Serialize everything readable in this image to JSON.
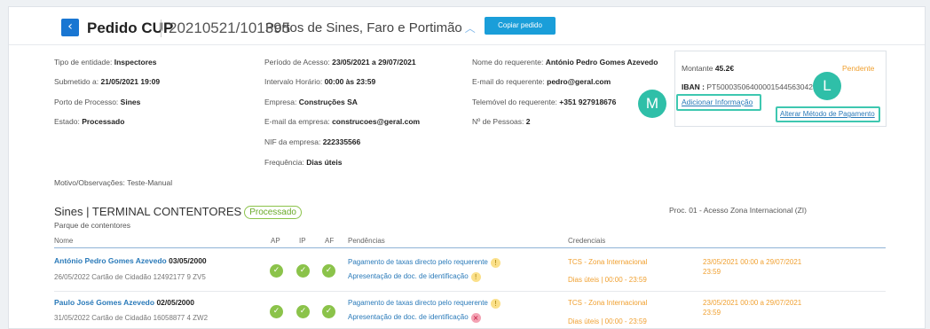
{
  "header": {
    "back_icon": "chevron-left-icon",
    "title": "Pedido CUP",
    "request_id": "20210521/101395",
    "ports": "Portos de Sines, Faro e Portimão",
    "copy_button": "Copiar pedido"
  },
  "details": {
    "col1": [
      {
        "label": "Tipo de entidade:",
        "value": "Inspectores"
      },
      {
        "label": "Submetido a:",
        "value": "21/05/2021 19:09"
      },
      {
        "label": "Porto de Processo:",
        "value": "Sines"
      },
      {
        "label": "Estado:",
        "value": "Processado"
      }
    ],
    "col2": [
      {
        "label": "Período de Acesso:",
        "value": "23/05/2021 a 29/07/2021"
      },
      {
        "label": "Intervalo Horário:",
        "value": "00:00 às 23:59"
      },
      {
        "label": "Empresa:",
        "value": "Construções SA"
      },
      {
        "label": "E-mail da empresa:",
        "value": "construcoes@geral.com"
      },
      {
        "label": "NIF da empresa:",
        "value": "222335566"
      },
      {
        "label": "Frequência:",
        "value": "Dias úteis"
      }
    ],
    "col3": [
      {
        "label": "Nome do requerente:",
        "value": "António Pedro Gomes Azevedo"
      },
      {
        "label": "E-mail do requerente:",
        "value": "pedro@geral.com"
      },
      {
        "label": "Telemóvel do requerente:",
        "value": "+351 927918676"
      },
      {
        "label": "Nº de Pessoas:",
        "value": "2"
      }
    ],
    "motivo": {
      "label": "Motivo/Observações:",
      "value": "Teste-Manual"
    }
  },
  "payment": {
    "amount_label": "Montante",
    "amount_value": "45.2€",
    "status": "Pendente",
    "iban_label": "IBAN :",
    "iban_value": "PT50003506400001544563042",
    "add_info_link": "Adicionar Informação",
    "change_method_link": "Alterar Método de Pagamento",
    "bubble_m": "M",
    "bubble_l": "L"
  },
  "section": {
    "title": "Sines | TERMINAL CONTENTORES",
    "badge": "Processado",
    "subtitle": "Parque de contentores",
    "proc": "Proc. 01 - Acesso Zona Internacional (ZI)"
  },
  "table": {
    "headers": {
      "nome": "Nome",
      "ap": "AP",
      "ip": "IP",
      "af": "AF",
      "pend": "Pendências",
      "cred": "Credenciais"
    },
    "rows": [
      {
        "name": "António Pedro Gomes Azevedo",
        "date": "03/05/2000",
        "doc": "26/05/2022   Cartão de Cidadão   12492177 9 ZV5",
        "pend1": "Pagamento de taxas directo pelo requerente",
        "pend2": "Apresentação de doc. de identificação",
        "cred1": "TCS - Zona Internacional",
        "cred2": "Dias úteis | 00:00 - 23:59",
        "period1": "23/05/2021 00:00  a  29/07/2021",
        "period2": "23:59"
      },
      {
        "name": "Paulo José Gomes Azevedo",
        "date": "02/05/2000",
        "doc": "31/05/2022   Cartão de Cidadão   16058877 4 ZW2",
        "pend1": "Pagamento de taxas directo pelo requerente",
        "pend2": "Apresentação de doc. de identificação",
        "cred1": "TCS - Zona Internacional",
        "cred2": "Dias úteis | 00:00 - 23:59",
        "period1": "23/05/2021 00:00  a  29/07/2021",
        "period2": "23:59"
      }
    ]
  },
  "icons": {
    "check": "check-icon",
    "warning": "warning-icon",
    "error": "error-icon"
  },
  "colors": {
    "accent": "#1a9ed9",
    "ok": "#8bc34a",
    "warn": "#f0a030",
    "highlight": "#3ec7b0"
  }
}
